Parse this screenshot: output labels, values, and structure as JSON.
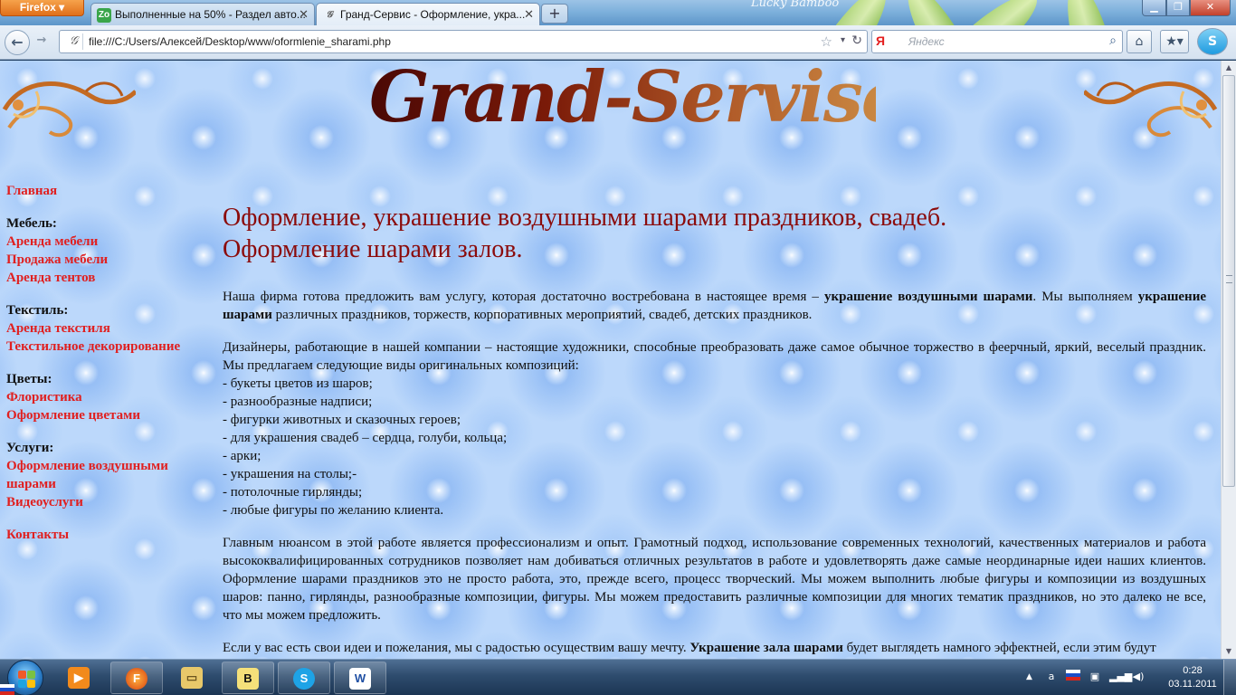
{
  "browser": {
    "menu_button": "Firefox",
    "tabs": [
      {
        "title": "Выполненные на 50% - Раздел авто...",
        "favicon": "zoho-icon",
        "active": false
      },
      {
        "title": "Гранд-Сервис - Оформление, укра...",
        "favicon": "page-icon",
        "active": true
      }
    ],
    "theme_text": "Lucky Bamboo",
    "url": "file:///C:/Users/Алексей/Desktop/www/oformlenie_sharami.php",
    "search_engine": "Я",
    "search_placeholder": "Яндекс"
  },
  "site": {
    "logo_text": "Grand-Servise",
    "nav": [
      {
        "type": "link",
        "label": "Главная"
      },
      {
        "type": "header",
        "label": "Мебель:"
      },
      {
        "type": "link",
        "label": "Аренда мебели"
      },
      {
        "type": "link",
        "label": "Продажа мебели"
      },
      {
        "type": "link",
        "label": "Аренда тентов"
      },
      {
        "type": "header",
        "label": "Текстиль:"
      },
      {
        "type": "link",
        "label": "Аренда текстиля"
      },
      {
        "type": "link",
        "label": "Текстильное декорирование"
      },
      {
        "type": "header",
        "label": "Цветы:"
      },
      {
        "type": "link",
        "label": "Флористика"
      },
      {
        "type": "link",
        "label": "Оформление цветами"
      },
      {
        "type": "header",
        "label": "Услуги:"
      },
      {
        "type": "link",
        "label": "Оформление воздушными шарами"
      },
      {
        "type": "link",
        "label": "Видеоуслуги"
      },
      {
        "type": "link",
        "label": "Контакты",
        "gap": true
      }
    ],
    "heading_line1": "Оформление, украшение воздушными шарами праздников, свадеб.",
    "heading_line2": "Оформление шарами залов.",
    "p1": {
      "a": "Наша фирма готова предложить вам услугу, которая достаточно востребована в настоящее время – ",
      "b1": "украшение воздушными шарами",
      "c": ". Мы выполняем ",
      "b2": "украшение шарами",
      "d": " различных праздников, торжеств, корпоративных мероприятий, свадеб, детских праздников."
    },
    "p2_intro": "Дизайнеры, работающие в нашей компании – настоящие художники, способные преобразовать даже самое обычное торжество в феерчный, яркий, веселый праздник. Мы предлагаем следующие виды оригинальных композиций:",
    "p2_items": [
      "- букеты цветов из шаров;",
      "- разнообразные надписи;",
      "- фигурки животных и сказочных героев;",
      "- для украшения свадеб – сердца, голуби, кольца;",
      "- арки;",
      "- украшения на столы;-",
      "- потолочные гирлянды;",
      "- любые фигуры по желанию клиента."
    ],
    "p3": "Главным нюансом в этой работе является профессионализм и опыт. Грамотный подход, использование современных технологий, качественных материалов и работа высококвалифицированных сотрудников позволяет нам добиваться отличных результатов в работе и удовлетворять даже самые неординарные идеи наших клиентов. Оформление шарами праздников это не просто работа, это, прежде всего, процесс творческий. Мы можем выполнить любые фигуры и композиции из воздушных шаров: панно, гирлянды, разнообразные композиции, фигуры. Мы можем предоставить различные композиции для многих тематик праздников, но это далеко не все, что мы можем предложить.",
    "p4": {
      "a": "Если у вас есть свои идеи и пожелания, мы с радостью осуществим вашу мечту. ",
      "b": "Украшение зала шарами",
      "c": " будет выглядеть намного эффектней, если этим будут"
    }
  },
  "taskbar": {
    "pinned": [
      {
        "name": "media-player-icon",
        "glyph": "▶"
      },
      {
        "name": "firefox-icon",
        "glyph": "F"
      },
      {
        "name": "explorer-folder-icon",
        "glyph": "▭"
      },
      {
        "name": "batman-app-icon",
        "glyph": "B"
      },
      {
        "name": "skype-icon",
        "glyph": "S"
      },
      {
        "name": "word-icon",
        "glyph": "W"
      }
    ],
    "time": "0:28",
    "date": "03.11.2011"
  },
  "colors": {
    "nav_link": "#e02020",
    "heading": "#8b0b0b",
    "page_bg": "#bcd8fb"
  }
}
